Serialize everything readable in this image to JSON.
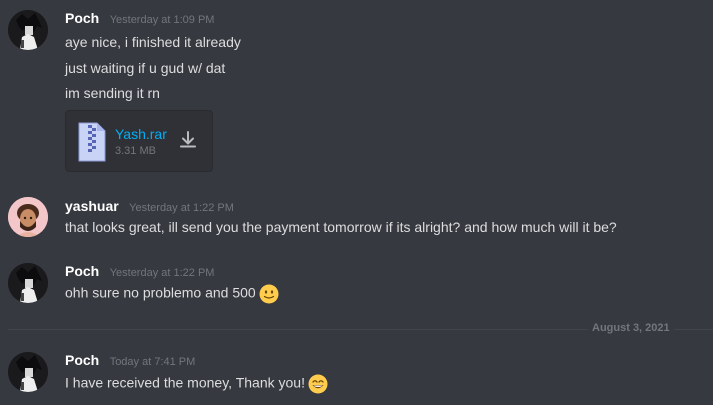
{
  "messages": [
    {
      "username": "Poch",
      "timestamp": "Yesterday at 1:09 PM",
      "lines": [
        "aye nice, i finished it already",
        "just waiting if u gud w/ dat",
        "im sending it rn"
      ],
      "attachment": {
        "name": "Yash.rar",
        "size": "3.31 MB",
        "icon": "zip-file-icon"
      }
    },
    {
      "username": "yashuar",
      "timestamp": "Yesterday at 1:22 PM",
      "lines": [
        "that looks great, ill send you the payment tomorrow if its alright? and how much will it be?"
      ]
    },
    {
      "username": "Poch",
      "timestamp": "Yesterday at 1:22 PM",
      "lines": [
        "ohh sure no problemo and 500"
      ],
      "emoji": "slightly-smiling-face"
    },
    {
      "username": "Poch",
      "timestamp": "Today at 7:41 PM",
      "lines": [
        "I have received the money, Thank you!"
      ],
      "emoji": "grinning-smiling-eyes"
    }
  ],
  "date_divider": "August 3, 2021",
  "colors": {
    "background": "#36393f",
    "username": "#ffffff",
    "text": "#dcddde",
    "timestamp": "#72767d",
    "link": "#00aff4"
  }
}
